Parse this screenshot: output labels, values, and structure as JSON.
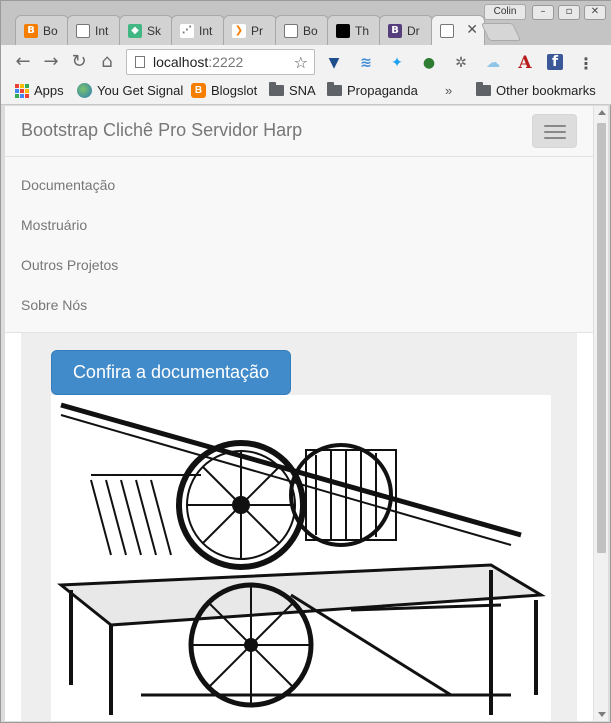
{
  "browser": {
    "tabs": [
      {
        "label": "Bo",
        "favicon": "blogger-icon",
        "color": "#f57d00",
        "glyph": "B"
      },
      {
        "label": "Int",
        "favicon": "page-icon",
        "color": "#ffffff",
        "glyph": ""
      },
      {
        "label": "Sk",
        "favicon": "vue-icon",
        "color": "#41b883",
        "glyph": "◆"
      },
      {
        "label": "Int",
        "favicon": "diagram-icon",
        "color": "#ffffff",
        "glyph": ""
      },
      {
        "label": "Pr",
        "favicon": "code-icon",
        "color": "#ffffff",
        "glyph": "❯"
      },
      {
        "label": "Bo",
        "favicon": "page-icon",
        "color": "#ffffff",
        "glyph": ""
      },
      {
        "label": "Th",
        "favicon": "black-square-icon",
        "color": "#000000",
        "glyph": ""
      },
      {
        "label": "Dr",
        "favicon": "bootstrap-icon",
        "color": "#563d7c",
        "glyph": "B"
      },
      {
        "label": "",
        "favicon": "page-icon",
        "color": "#ffffff",
        "glyph": ""
      }
    ],
    "active_tab_index": 8,
    "profile_name": "Colin",
    "address": {
      "host": "localhost",
      "port": ":2222"
    },
    "bookmarks": [
      {
        "label": "Apps",
        "icon": "apps-grid-icon"
      },
      {
        "label": "You Get Signal",
        "icon": "globe-icon"
      },
      {
        "label": "Blogslot",
        "icon": "blogger-icon"
      },
      {
        "label": "SNA",
        "icon": "folder-icon"
      },
      {
        "label": "Propaganda",
        "icon": "folder-icon"
      }
    ],
    "overflow_chevron": "»",
    "other_bookmarks": "Other bookmarks"
  },
  "page": {
    "brand": "Bootstrap Clichê Pro Servidor Harp",
    "menu": [
      {
        "label": "Documentação"
      },
      {
        "label": "Mostruário"
      },
      {
        "label": "Outros Projetos"
      },
      {
        "label": "Sobre Nós"
      }
    ],
    "cta_label": "Confira a documentação",
    "image_alt": "Printing press engraving"
  },
  "colors": {
    "primary": "#428bca",
    "navbar_bg": "#f8f8f8",
    "content_bg": "#eeeeee"
  }
}
